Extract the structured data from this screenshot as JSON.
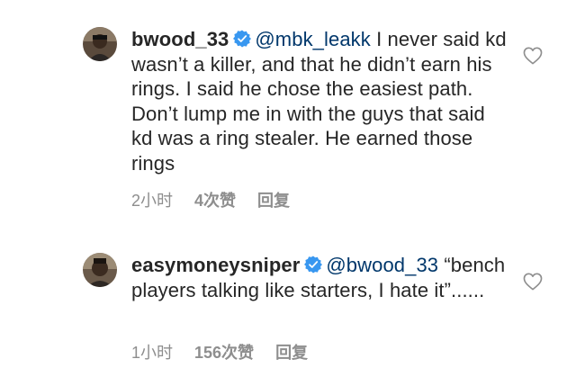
{
  "comments": [
    {
      "username": "bwood_33",
      "mention": "@mbk_leakk",
      "text": " I never said kd wasn’t a killer, and that he didn’t earn his rings. I said he chose the easiest path. Don’t lump me in with the guys that said kd was a ring stealer. He earned those rings",
      "time": "2小时",
      "likes": "4次赞",
      "reply": "回复",
      "verified_icon": "verified-badge-icon",
      "like_icon": "heart-outline-icon"
    },
    {
      "username": "easymoneysniper",
      "mention": "@bwood_33",
      "text": " “bench players talking like starters, I hate it”......",
      "time": "1小时",
      "likes": "156次赞",
      "reply": "回复",
      "verified_icon": "verified-badge-icon",
      "like_icon": "heart-outline-icon"
    }
  ],
  "colors": {
    "text": "#262626",
    "mention": "#00376b",
    "meta": "#8e8e8e",
    "verified": "#3897f0"
  }
}
